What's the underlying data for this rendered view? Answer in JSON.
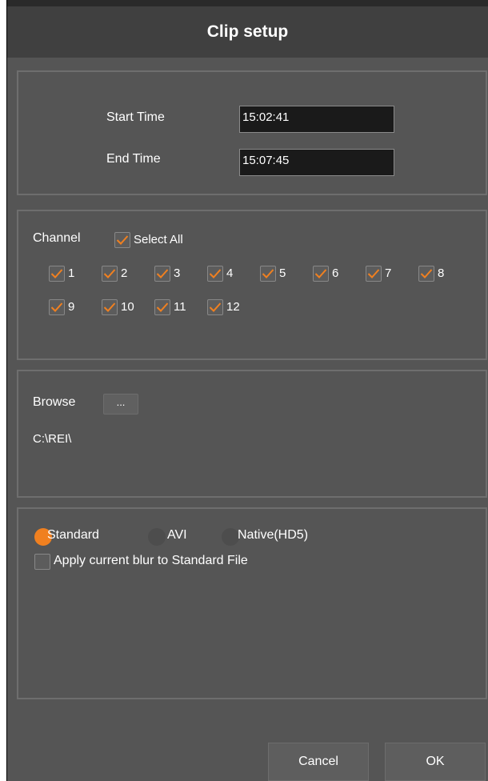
{
  "dialog": {
    "title": "Clip setup"
  },
  "time": {
    "start_label": "Start Time",
    "start_value": "15:02:41",
    "end_label": "End Time",
    "end_value": "15:07:45"
  },
  "channel": {
    "label": "Channel",
    "select_all_label": "Select All",
    "select_all_checked": true,
    "channels": [
      {
        "label": "1",
        "checked": true
      },
      {
        "label": "2",
        "checked": true
      },
      {
        "label": "3",
        "checked": true
      },
      {
        "label": "4",
        "checked": true
      },
      {
        "label": "5",
        "checked": true
      },
      {
        "label": "6",
        "checked": true
      },
      {
        "label": "7",
        "checked": true
      },
      {
        "label": "8",
        "checked": true
      },
      {
        "label": "9",
        "checked": true
      },
      {
        "label": "10",
        "checked": true
      },
      {
        "label": "11",
        "checked": true
      },
      {
        "label": "12",
        "checked": true
      }
    ]
  },
  "browse": {
    "label": "Browse",
    "button_label": "...",
    "path": "C:\\REI\\"
  },
  "format": {
    "options": [
      {
        "label": "Standard",
        "selected": true
      },
      {
        "label": "AVI",
        "selected": false
      },
      {
        "label": "Native(HD5)",
        "selected": false
      }
    ],
    "blur_label": "Apply current blur to Standard File",
    "blur_checked": false
  },
  "buttons": {
    "cancel": "Cancel",
    "ok": "OK"
  },
  "colors": {
    "accent": "#f08020",
    "background": "#555555",
    "titlebar": "#404040"
  }
}
